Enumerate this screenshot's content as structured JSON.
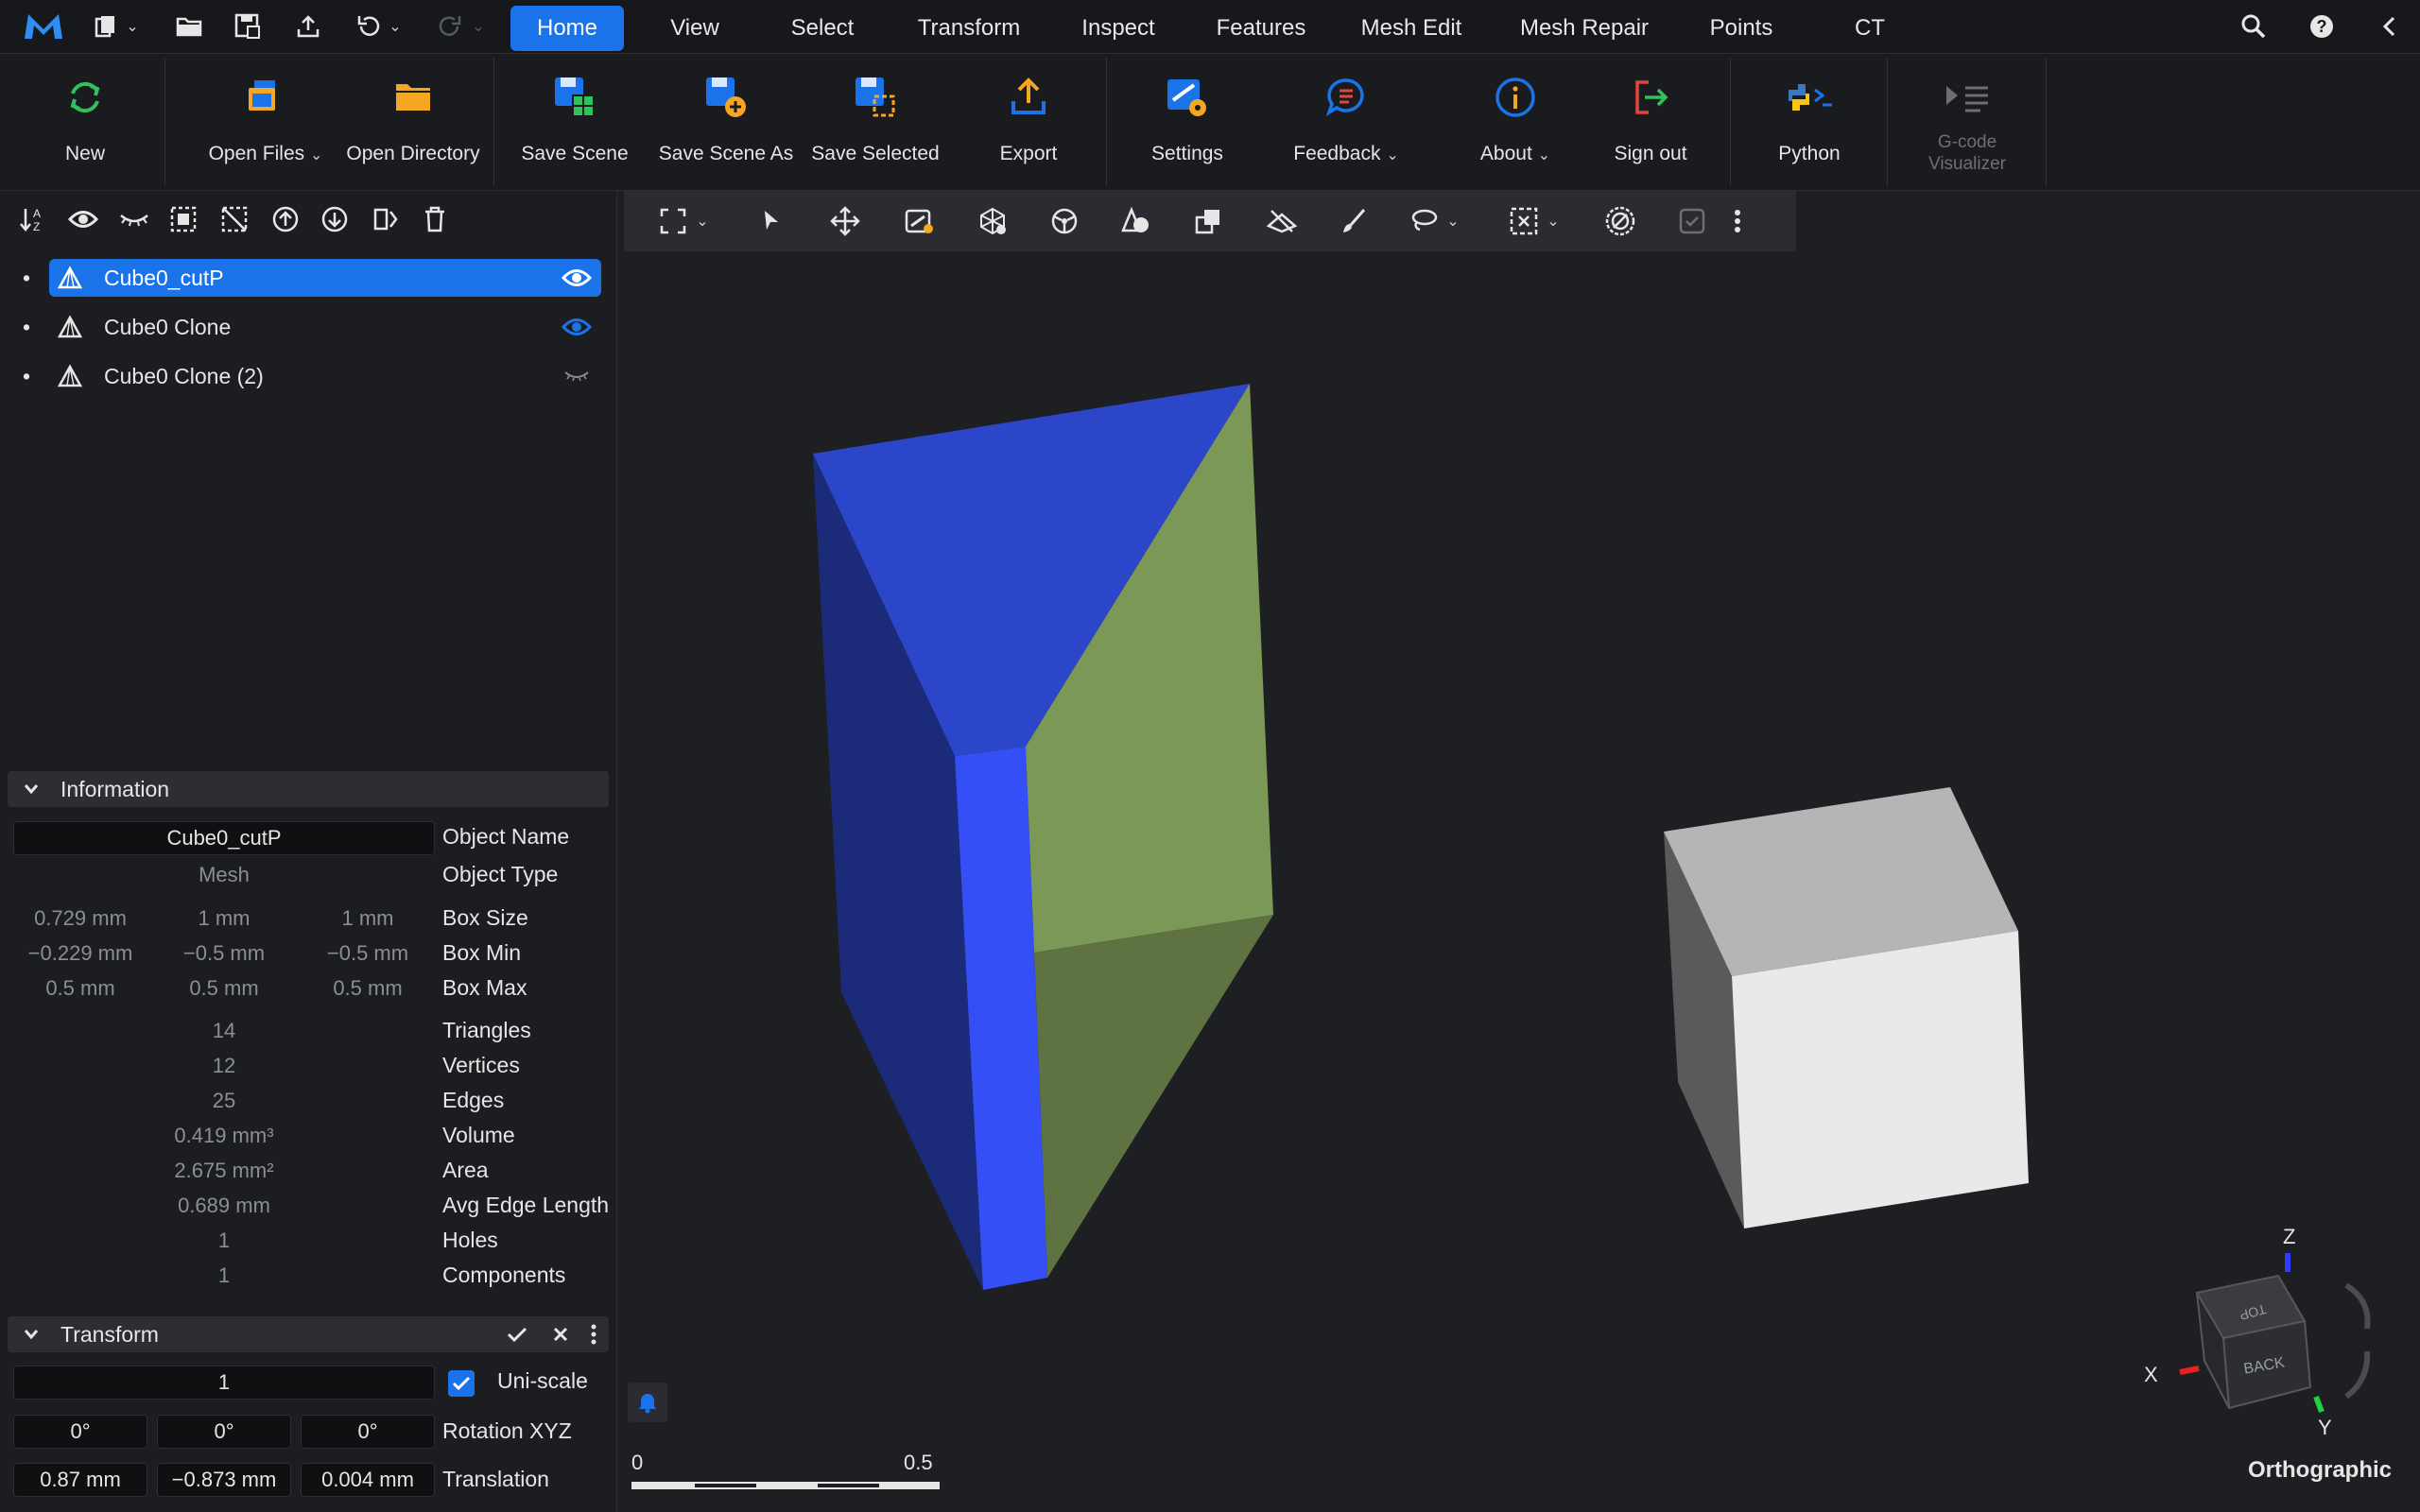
{
  "menubar": {
    "tabs": [
      {
        "label": "Home",
        "active": true
      },
      {
        "label": "View"
      },
      {
        "label": "Select"
      },
      {
        "label": "Transform"
      },
      {
        "label": "Inspect"
      },
      {
        "label": "Features"
      },
      {
        "label": "Mesh Edit"
      },
      {
        "label": "Mesh Repair"
      },
      {
        "label": "Points"
      },
      {
        "label": "CT"
      }
    ]
  },
  "ribbon": {
    "new": "New",
    "open_files": "Open Files",
    "open_directory": "Open Directory",
    "save_scene": "Save Scene",
    "save_scene_as": "Save Scene As",
    "save_selected": "Save Selected",
    "export": "Export",
    "settings": "Settings",
    "feedback": "Feedback",
    "about": "About",
    "sign_out": "Sign out",
    "python": "Python",
    "gcode": "G-code Visualizer"
  },
  "scene_tree": [
    {
      "name": "Cube0_cutP",
      "visible": true,
      "selected": true
    },
    {
      "name": "Cube0 Clone",
      "visible": true
    },
    {
      "name": "Cube0 Clone (2)",
      "visible": false
    }
  ],
  "information": {
    "title": "Information",
    "object_name_value": "Cube0_cutP",
    "object_name_label": "Object Name",
    "object_type_value": "Mesh",
    "object_type_label": "Object Type",
    "box_size": [
      "0.729 mm",
      "1 mm",
      "1 mm"
    ],
    "box_size_label": "Box Size",
    "box_min": [
      "−0.229 mm",
      "−0.5 mm",
      "−0.5 mm"
    ],
    "box_min_label": "Box Min",
    "box_max": [
      "0.5 mm",
      "0.5 mm",
      "0.5 mm"
    ],
    "box_max_label": "Box Max",
    "stats": [
      {
        "value": "14",
        "label": "Triangles"
      },
      {
        "value": "12",
        "label": "Vertices"
      },
      {
        "value": "25",
        "label": "Edges"
      },
      {
        "value": "0.419 mm³",
        "label": "Volume"
      },
      {
        "value": "2.675 mm²",
        "label": "Area"
      },
      {
        "value": "0.689 mm",
        "label": "Avg Edge Length"
      },
      {
        "value": "1",
        "label": "Holes"
      },
      {
        "value": "1",
        "label": "Components"
      }
    ]
  },
  "transform": {
    "title": "Transform",
    "scale": "1",
    "uniscale_label": "Uni-scale",
    "uniscale_checked": true,
    "rotation": [
      "0°",
      "0°",
      "0°"
    ],
    "rotation_label": "Rotation XYZ",
    "translation": [
      "0.87 mm",
      "−0.873 mm",
      "0.004 mm"
    ],
    "translation_label": "Translation"
  },
  "viewport": {
    "scale_start": "0",
    "scale_end": "0.5",
    "projection": "Orthographic",
    "axes": {
      "x": "X",
      "y": "Y",
      "z": "Z"
    },
    "cube_faces": {
      "top": "TOP",
      "back": "BACK"
    }
  },
  "colors": {
    "accent": "#1a73e8",
    "prism_top": "#2b46c8",
    "prism_side": "#1b2b7a",
    "prism_front": "#344ff5",
    "prism_green_light": "#7c9856",
    "prism_green_dark": "#5e7242",
    "cube_top": "#b5b5b5",
    "cube_front": "#e9e9e9",
    "cube_side": "#5a5a5a"
  }
}
